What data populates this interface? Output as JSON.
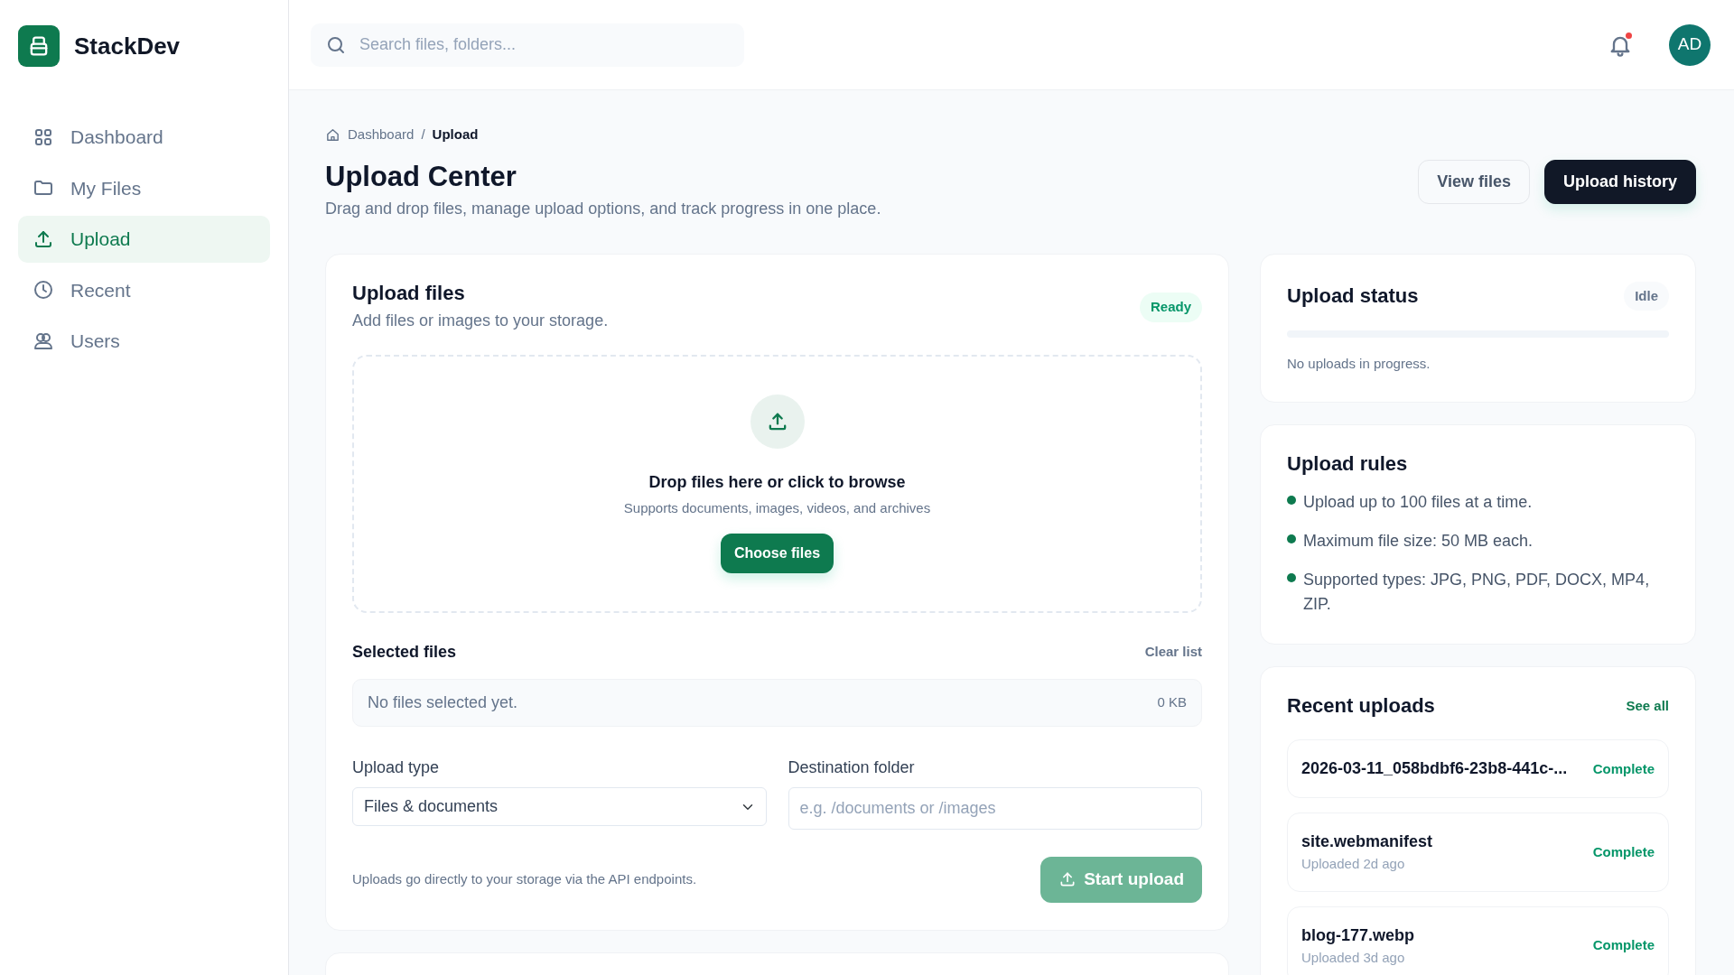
{
  "brand": {
    "name": "StackDev"
  },
  "sidebar": {
    "items": [
      {
        "label": "Dashboard",
        "selected": false
      },
      {
        "label": "My Files",
        "selected": false
      },
      {
        "label": "Upload",
        "selected": true
      },
      {
        "label": "Recent",
        "selected": false
      },
      {
        "label": "Users",
        "selected": false
      }
    ]
  },
  "topbar": {
    "search": {
      "placeholder": "Search files, folders..."
    },
    "notifications": {
      "unread": true
    },
    "avatar": {
      "initials": "AD"
    }
  },
  "breadcrumb": {
    "separator": "/",
    "items": [
      {
        "label": "Dashboard",
        "current": false
      },
      {
        "label": "Upload",
        "current": true
      }
    ]
  },
  "page": {
    "title": "Upload Center",
    "subtitle": "Drag and drop files, manage upload options, and track progress in one place.",
    "actions": [
      {
        "label": "View files",
        "kind": "secondary"
      },
      {
        "label": "Upload history",
        "kind": "primary"
      }
    ]
  },
  "upload_card": {
    "title": "Upload files",
    "subtitle": "Add files or images to your storage.",
    "badge": "Ready",
    "dropzone": {
      "title": "Drop files here or click to browse",
      "hint": "Supports documents, images, videos, and archives",
      "button": "Choose files"
    },
    "selected_files": {
      "label": "Selected files",
      "clear": "Clear list",
      "empty": "No files selected yet.",
      "size": "0 KB"
    },
    "upload_type": {
      "label": "Upload type",
      "value": "Files & documents"
    },
    "destination": {
      "label": "Destination folder",
      "placeholder": "e.g. /documents or /images"
    },
    "note": "Uploads go directly to your storage via the API endpoints.",
    "start_button": {
      "label": "Start upload",
      "disabled": true
    }
  },
  "status_card": {
    "title": "Upload status",
    "badge": "Idle",
    "level": 0,
    "message": "No uploads in progress."
  },
  "rules_card": {
    "title": "Upload rules",
    "items": [
      "Upload up to 100 files at a time.",
      "Maximum file size: 50 MB each.",
      "Supported types: JPG, PNG, PDF, DOCX, MP4, ZIP."
    ]
  },
  "recent_card": {
    "title": "Recent uploads",
    "link": "See all",
    "items": [
      {
        "name": "2026-03-11_058bdbf6-23b8-441c-...",
        "status": "Complete"
      },
      {
        "name": "site.webmanifest",
        "meta": "Uploaded 2d ago",
        "status": "Complete"
      },
      {
        "name": "blog-177.webp",
        "meta": "Uploaded 3d ago",
        "status": "Complete"
      }
    ]
  }
}
